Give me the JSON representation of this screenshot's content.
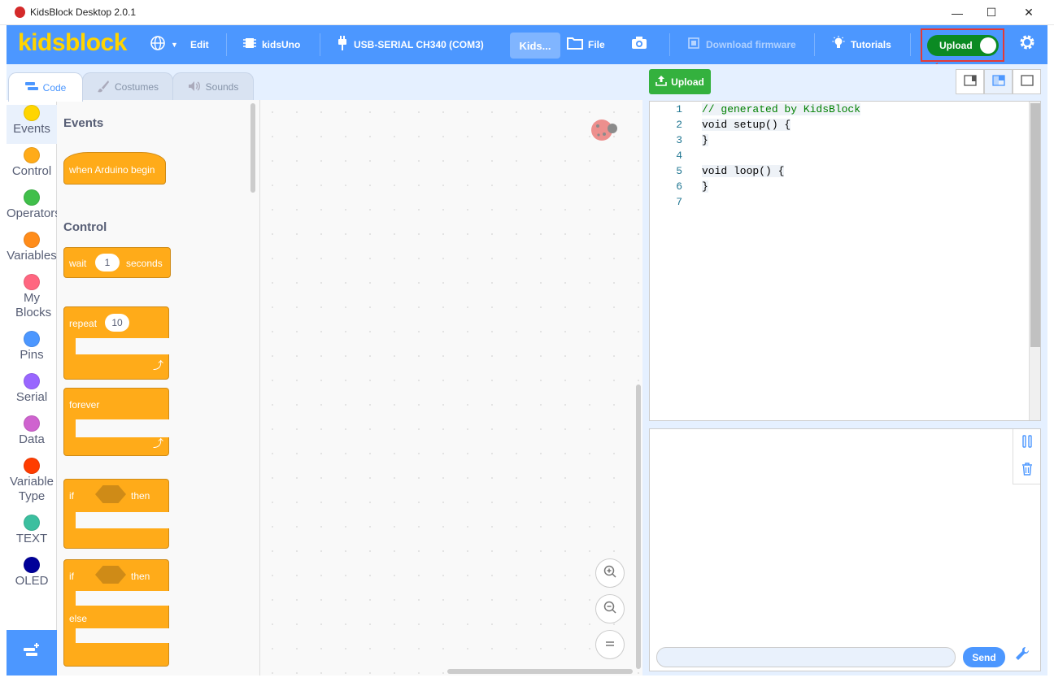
{
  "window": {
    "title": "KidsBlock Desktop 2.0.1",
    "minimize": "—",
    "maximize": "☐",
    "close": "✕"
  },
  "menubar": {
    "logo": "kidsblock",
    "edit": "Edit",
    "board": "kidsUno",
    "port": "USB-SERIAL CH340 (COM3)",
    "project_tab": "Kids...",
    "file": "File",
    "download_firmware": "Download firmware",
    "tutorials": "Tutorials",
    "upload_toggle": "Upload"
  },
  "tabs": [
    {
      "label": "Code",
      "icon": "code-icon"
    },
    {
      "label": "Costumes",
      "icon": "brush-icon"
    },
    {
      "label": "Sounds",
      "icon": "speaker-icon"
    }
  ],
  "categories": [
    {
      "label": "Events",
      "color": "#ffd500"
    },
    {
      "label": "Control",
      "color": "#ffab19"
    },
    {
      "label": "Operators",
      "color": "#40bf4a"
    },
    {
      "label": "Variables",
      "color": "#ff8c1a"
    },
    {
      "label": "My Blocks",
      "color": "#ff6680"
    },
    {
      "label": "Pins",
      "color": "#4c97ff"
    },
    {
      "label": "Serial",
      "color": "#9966ff"
    },
    {
      "label": "Data",
      "color": "#cf63cf"
    },
    {
      "label": "Variable Type",
      "color": "#ff3d00"
    },
    {
      "label": "TEXT",
      "color": "#3bbf9f"
    },
    {
      "label": "OLED",
      "color": "#000099"
    }
  ],
  "palette": {
    "events_heading": "Events",
    "when_arduino_begin": "when Arduino begin",
    "control_heading": "Control",
    "wait": "wait",
    "wait_value": "1",
    "seconds": "seconds",
    "repeat": "repeat",
    "repeat_value": "10",
    "forever": "forever",
    "if1": "if",
    "then1": "then",
    "if2": "if",
    "then2": "then",
    "else": "else"
  },
  "right": {
    "upload_button": "Upload",
    "send_button": "Send"
  },
  "code_lines": [
    {
      "n": "1",
      "text": "// generated by KidsBlock"
    },
    {
      "n": "2",
      "text": "void setup() {"
    },
    {
      "n": "3",
      "text": "}"
    },
    {
      "n": "4",
      "text": ""
    },
    {
      "n": "5",
      "text": "void loop() {"
    },
    {
      "n": "6",
      "text": "}"
    },
    {
      "n": "7",
      "text": ""
    }
  ],
  "colors": {
    "accent": "#4c97ff",
    "upload_toggle": "#0b8a23",
    "highlight": "#e53935"
  }
}
